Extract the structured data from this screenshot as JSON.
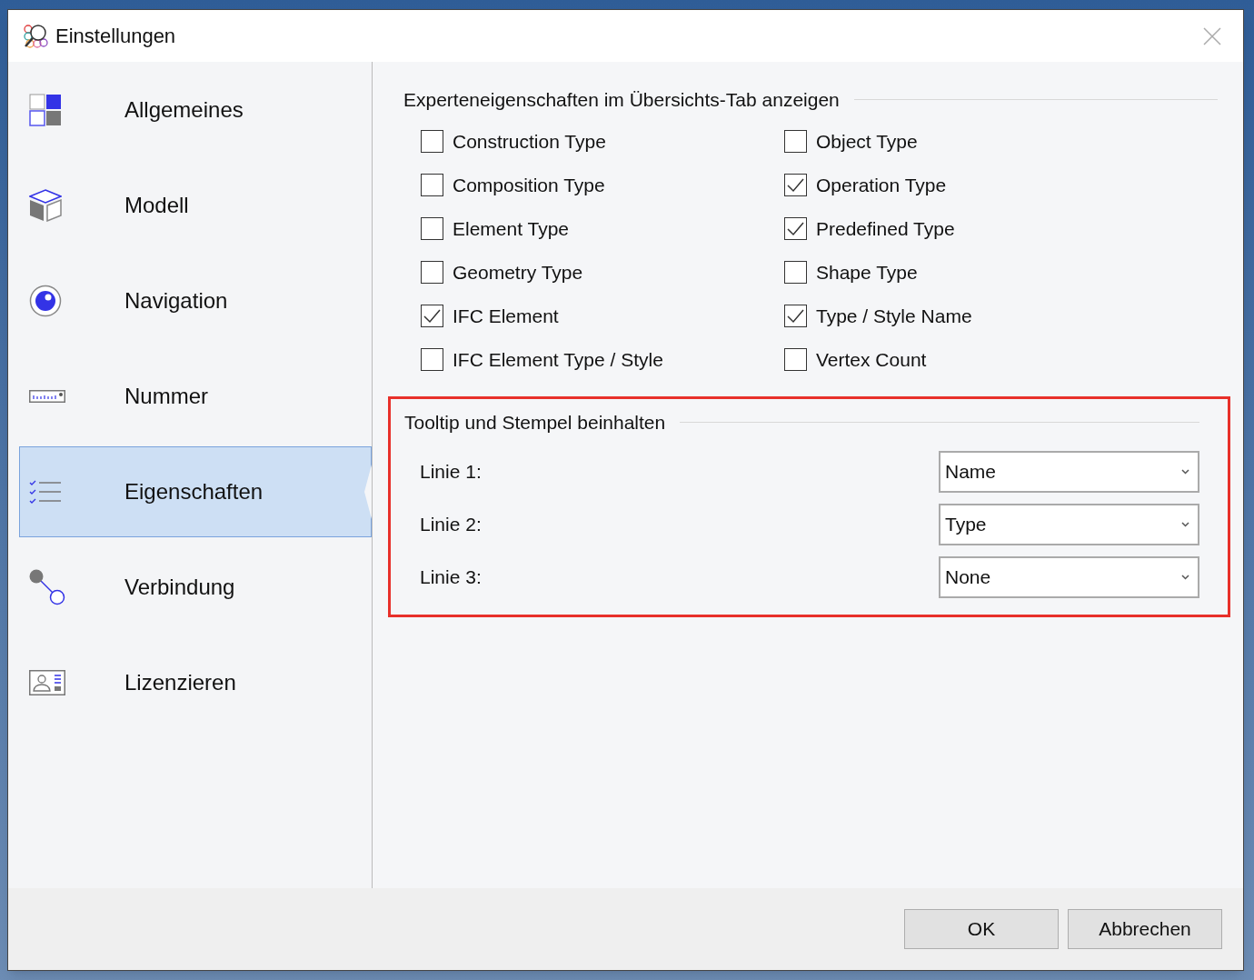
{
  "window": {
    "title": "Einstellungen"
  },
  "sidebar": {
    "items": [
      {
        "label": "Allgemeines",
        "kind": "tiles",
        "selected": false
      },
      {
        "label": "Modell",
        "kind": "cube",
        "selected": false
      },
      {
        "label": "Navigation",
        "kind": "eye",
        "selected": false
      },
      {
        "label": "Nummer",
        "kind": "ruler",
        "selected": false
      },
      {
        "label": "Eigenschaften",
        "kind": "checklist",
        "selected": true
      },
      {
        "label": "Verbindung",
        "kind": "link",
        "selected": false
      },
      {
        "label": "Lizenzieren",
        "kind": "card",
        "selected": false
      }
    ]
  },
  "expert_properties": {
    "title": "Experteneigenschaften im Übersichts-Tab anzeigen",
    "options": [
      {
        "label": "Construction Type",
        "checked": false
      },
      {
        "label": "Object Type",
        "checked": false
      },
      {
        "label": "Composition Type",
        "checked": false
      },
      {
        "label": "Operation Type",
        "checked": true
      },
      {
        "label": "Element Type",
        "checked": false
      },
      {
        "label": "Predefined Type",
        "checked": true
      },
      {
        "label": "Geometry Type",
        "checked": false
      },
      {
        "label": "Shape Type",
        "checked": false
      },
      {
        "label": "IFC Element",
        "checked": true
      },
      {
        "label": "Type / Style Name",
        "checked": true
      },
      {
        "label": "IFC Element Type / Style",
        "checked": false
      },
      {
        "label": "Vertex Count",
        "checked": false
      }
    ]
  },
  "tooltip": {
    "title": "Tooltip und Stempel beinhalten",
    "highlighted": true,
    "lines": [
      {
        "label": "Linie 1:",
        "value": "Name"
      },
      {
        "label": "Linie 2:",
        "value": "Type"
      },
      {
        "label": "Linie 3:",
        "value": "None"
      }
    ]
  },
  "buttons": [
    "OK",
    "Abbrechen"
  ]
}
